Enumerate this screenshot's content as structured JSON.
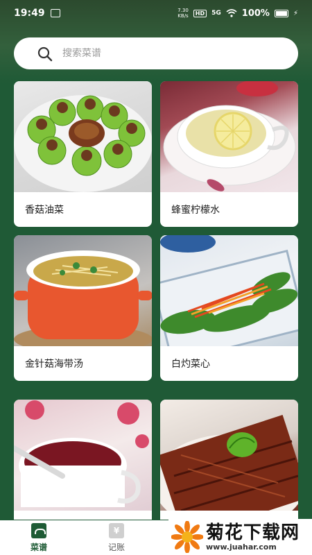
{
  "status_bar": {
    "time": "19:49",
    "net_speed_value": "7.30",
    "net_speed_unit": "KB/s",
    "hd": "HD",
    "signal": "5G",
    "battery_pct": "100%"
  },
  "search": {
    "placeholder": "搜索菜谱"
  },
  "recipes": [
    {
      "name": "香菇油菜"
    },
    {
      "name": "蜂蜜柠檬水"
    },
    {
      "name": "金针菇海带汤"
    },
    {
      "name": "白灼菜心"
    },
    {
      "name": ""
    },
    {
      "name": ""
    }
  ],
  "tabbar": {
    "recipes_label": "菜谱",
    "ledger_label": "记账",
    "ledger_icon_glyph": "¥"
  },
  "watermark": {
    "title": "菊花下载网",
    "url": "www.juahar.com"
  },
  "colors": {
    "accent": "#1e5b35",
    "background": "#1f5a36"
  }
}
